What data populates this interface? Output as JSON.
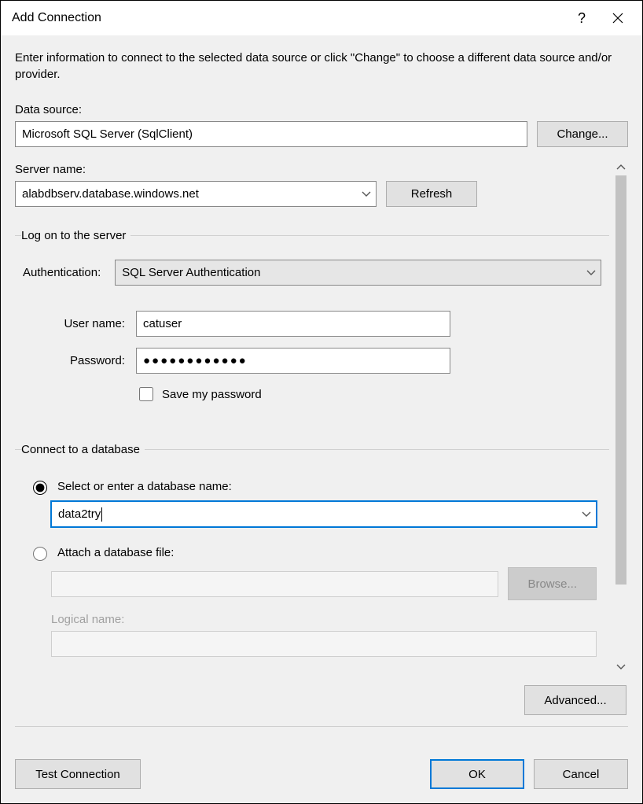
{
  "title": "Add Connection",
  "intro": "Enter information to connect to the selected data source or click \"Change\" to choose a different data source and/or provider.",
  "dataSource": {
    "label": "Data source:",
    "value": "Microsoft SQL Server (SqlClient)",
    "changeButton": "Change..."
  },
  "serverName": {
    "label": "Server name:",
    "value": "alabdbserv.database.windows.net",
    "refreshButton": "Refresh"
  },
  "logon": {
    "legend": "Log on to the server",
    "authLabel": "Authentication:",
    "authValue": "SQL Server Authentication",
    "userLabel": "User name:",
    "userValue": "catuser",
    "passwordLabel": "Password:",
    "passwordMask": "●●●●●●●●●●●●",
    "saveLabel": "Save my password"
  },
  "connectDb": {
    "legend": "Connect to a database",
    "selectRadio": "Select or enter a database name:",
    "dbName": "data2try",
    "attachRadio": "Attach a database file:",
    "browseButton": "Browse...",
    "logicalLabel": "Logical name:"
  },
  "advancedButton": "Advanced...",
  "footer": {
    "test": "Test Connection",
    "ok": "OK",
    "cancel": "Cancel"
  }
}
